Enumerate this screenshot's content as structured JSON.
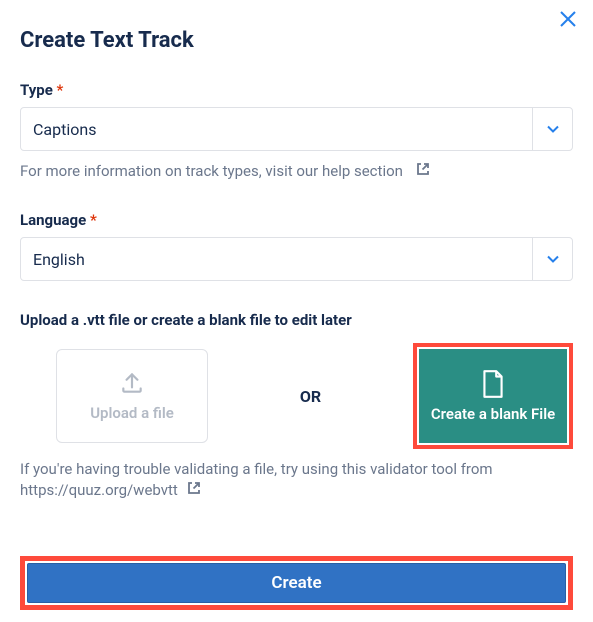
{
  "dialog": {
    "title": "Create Text Track"
  },
  "type_field": {
    "label": "Type",
    "required_mark": "*",
    "value": "Captions",
    "help_text": "For more information on track types, visit our help section"
  },
  "language_field": {
    "label": "Language",
    "required_mark": "*",
    "value": "English"
  },
  "upload_section": {
    "label": "Upload a .vtt file or create a blank file to edit later",
    "upload_label": "Upload a file",
    "or_label": "OR",
    "blank_label": "Create a blank File",
    "help_text": "If you're having trouble validating a file, try using this validator tool from https://quuz.org/webvtt"
  },
  "actions": {
    "create_label": "Create"
  }
}
